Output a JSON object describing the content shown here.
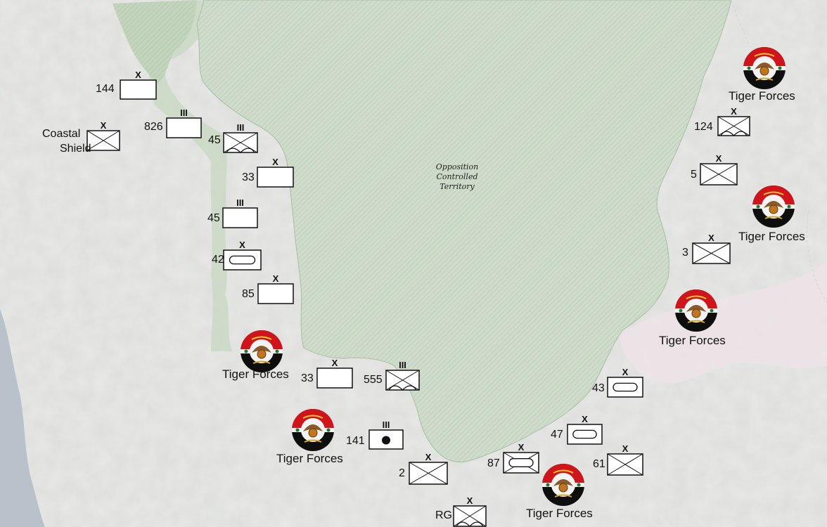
{
  "map_title_label": [
    "Opposition",
    "Controlled",
    "Territory"
  ],
  "emblem_caption": "Tiger Forces",
  "unit_symbols": {
    "brigade": "X",
    "regiment": "III"
  },
  "units": [
    {
      "id": "144",
      "size": "X",
      "type": "blank"
    },
    {
      "id": "826",
      "size": "III",
      "type": "blank"
    },
    {
      "id": "Coastal Shield",
      "size": "X",
      "type": "infantry"
    },
    {
      "id": "45",
      "size": "III",
      "type": "mountain"
    },
    {
      "id": "33",
      "size": "X",
      "type": "blank"
    },
    {
      "id": "45",
      "size": "III",
      "type": "blank"
    },
    {
      "id": "42",
      "size": "X",
      "type": "armor"
    },
    {
      "id": "85",
      "size": "X",
      "type": "blank"
    },
    {
      "id": "33",
      "size": "X",
      "type": "blank"
    },
    {
      "id": "555",
      "size": "III",
      "type": "mountain"
    },
    {
      "id": "141",
      "size": "III",
      "type": "dot"
    },
    {
      "id": "2",
      "size": "X",
      "type": "infantry"
    },
    {
      "id": "RG",
      "size": "X",
      "type": "mountain"
    },
    {
      "id": "87",
      "size": "X",
      "type": "mech"
    },
    {
      "id": "47",
      "size": "X",
      "type": "armor"
    },
    {
      "id": "61",
      "size": "X",
      "type": "infantry"
    },
    {
      "id": "43",
      "size": "X",
      "type": "armor"
    },
    {
      "id": "124",
      "size": "X",
      "type": "mountain"
    },
    {
      "id": "5",
      "size": "X",
      "type": "infantry"
    },
    {
      "id": "3",
      "size": "X",
      "type": "infantry"
    }
  ],
  "colors": {
    "land": "#e9eae7",
    "sea": "#b9c2cb",
    "opposition_area": "#cfdccb",
    "green_border_area": "#bfd2b9",
    "east_pink_area": "#ece3e6",
    "emblem_red": "#d0141b",
    "emblem_black": "#0e0e0e"
  }
}
